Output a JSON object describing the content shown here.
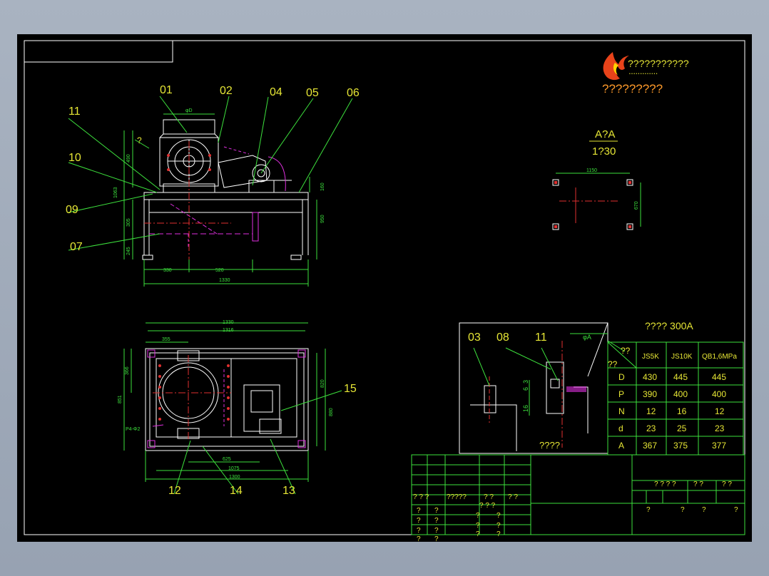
{
  "logo": {
    "title": "???????????",
    "subtitle": "?????????",
    "flame_color": "#e8431a"
  },
  "top_view": {
    "part_labels": [
      "01",
      "02",
      "04",
      "05",
      "06",
      "11",
      "10",
      "09",
      "07"
    ],
    "question": "?",
    "dims": {
      "phi_d": "φD",
      "height_1063": "1063",
      "height_490": "490",
      "height_305": "305",
      "height_245": "245",
      "height_160": "160",
      "height_950": "950",
      "width_330": "330",
      "width_520": "520",
      "width_1330": "1330"
    }
  },
  "section_aa": {
    "title": "A?A",
    "scale": "1?30",
    "dim_1150": "1150",
    "dim_670": "670"
  },
  "plan_view": {
    "part_labels": [
      "15",
      "12",
      "14",
      "13"
    ],
    "dims": {
      "w_1330": "1330",
      "w_1316": "1316",
      "w_355": "355",
      "h_366": "366",
      "h_851": "851",
      "h_820": "820",
      "h_880": "880",
      "w_625": "625",
      "w_1075": "1075",
      "w_1300": "1300",
      "mark": "P4-Φ2"
    }
  },
  "detail_view": {
    "part_labels": [
      "03",
      "08",
      "11"
    ],
    "phi_a": "φA",
    "dim_6": "6",
    "dim_3": "3",
    "dim_16": "16",
    "caption": "????"
  },
  "param_table": {
    "title": "????   300A",
    "corner_top": "??",
    "corner_left": "??",
    "columns": [
      "JS5K",
      "JS10K",
      "QB1,6MPa"
    ],
    "rows": [
      {
        "label": "D",
        "values": [
          "430",
          "445",
          "445"
        ]
      },
      {
        "label": "P",
        "values": [
          "390",
          "400",
          "400"
        ]
      },
      {
        "label": "N",
        "values": [
          "12",
          "16",
          "12"
        ]
      },
      {
        "label": "d",
        "values": [
          "23",
          "25",
          "23"
        ]
      },
      {
        "label": "A",
        "values": [
          "367",
          "375",
          "377"
        ]
      }
    ]
  },
  "title_block": {
    "left_header": [
      "? ? ?",
      "?????",
      "? ?",
      "? ?"
    ],
    "left_rows": [
      [
        "?",
        "?",
        "? ? ?"
      ],
      [
        "?",
        "?",
        "?",
        "?"
      ],
      [
        "?",
        "?",
        "?",
        "?"
      ],
      [
        "?",
        "?",
        "?",
        "?"
      ]
    ],
    "right_header": [
      "? ? ? ?",
      "? ?",
      "? ?"
    ],
    "right_bottom": [
      "?",
      "?",
      "?",
      "?"
    ]
  }
}
